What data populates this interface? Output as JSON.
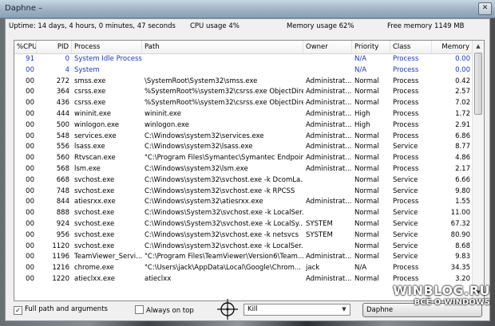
{
  "window": {
    "title": "Daphne –",
    "close_glyph": "✕"
  },
  "stats": {
    "uptime": "Uptime: 14 days, 4 hours, 0 minutes, 47 seconds",
    "cpu": "CPU usage  4%",
    "memory": "Memory usage  62%",
    "free": "Free memory 1149 MB"
  },
  "columns": [
    "%CPU",
    "PID",
    "Process",
    "Path",
    "Owner",
    "Priority",
    "Class",
    "Memory"
  ],
  "rows": [
    {
      "cpu": "91",
      "pid": "0",
      "process": "System Idle Process",
      "path": "",
      "owner": "",
      "priority": "N/A",
      "class": "Process",
      "memory": "0.00",
      "blue": true
    },
    {
      "cpu": "00",
      "pid": "4",
      "process": "System",
      "path": "",
      "owner": "",
      "priority": "N/A",
      "class": "Process",
      "memory": "0.00",
      "blue": true
    },
    {
      "cpu": "00",
      "pid": "272",
      "process": "smss.exe",
      "path": "\\SystemRoot\\System32\\smss.exe",
      "owner": "Administrat...",
      "priority": "Normal",
      "class": "Process",
      "memory": "0.42"
    },
    {
      "cpu": "00",
      "pid": "364",
      "process": "csrss.exe",
      "path": "%SystemRoot%\\system32\\csrss.exe ObjectDire...",
      "owner": "Administrat...",
      "priority": "Normal",
      "class": "Process",
      "memory": "2.57"
    },
    {
      "cpu": "00",
      "pid": "436",
      "process": "csrss.exe",
      "path": "%SystemRoot%\\system32\\csrss.exe ObjectDire...",
      "owner": "Administrat...",
      "priority": "Normal",
      "class": "Process",
      "memory": "7.02"
    },
    {
      "cpu": "00",
      "pid": "444",
      "process": "wininit.exe",
      "path": "wininit.exe",
      "owner": "Administrat...",
      "priority": "High",
      "class": "Process",
      "memory": "1.72"
    },
    {
      "cpu": "00",
      "pid": "500",
      "process": "winlogon.exe",
      "path": "winlogon.exe",
      "owner": "Administrat...",
      "priority": "High",
      "class": "Process",
      "memory": "2.91"
    },
    {
      "cpu": "00",
      "pid": "548",
      "process": "services.exe",
      "path": "C:\\Windows\\system32\\services.exe",
      "owner": "Administrat...",
      "priority": "Normal",
      "class": "Process",
      "memory": "6.86"
    },
    {
      "cpu": "00",
      "pid": "556",
      "process": "lsass.exe",
      "path": "C:\\Windows\\system32\\lsass.exe",
      "owner": "Administrat...",
      "priority": "Normal",
      "class": "Service",
      "memory": "8.77"
    },
    {
      "cpu": "00",
      "pid": "560",
      "process": "Rtvscan.exe",
      "path": "\"C:\\Program Files\\Symantec\\Symantec Endpoin...",
      "owner": "Administrat...",
      "priority": "Normal",
      "class": "Process",
      "memory": "4.86"
    },
    {
      "cpu": "00",
      "pid": "568",
      "process": "lsm.exe",
      "path": "C:\\Windows\\system32\\lsm.exe",
      "owner": "Administrat...",
      "priority": "Normal",
      "class": "Process",
      "memory": "2.17"
    },
    {
      "cpu": "00",
      "pid": "668",
      "process": "svchost.exe",
      "path": "C:\\Windows\\system32\\svchost.exe -k DcomLa...",
      "owner": "",
      "priority": "Normal",
      "class": "Service",
      "memory": "6.66"
    },
    {
      "cpu": "00",
      "pid": "748",
      "process": "svchost.exe",
      "path": "C:\\Windows\\system32\\svchost.exe -k RPCSS",
      "owner": "",
      "priority": "Normal",
      "class": "Service",
      "memory": "9.80"
    },
    {
      "cpu": "00",
      "pid": "844",
      "process": "atiesrxx.exe",
      "path": "C:\\Windows\\system32\\atiesrxx.exe",
      "owner": "Administrat...",
      "priority": "Normal",
      "class": "Process",
      "memory": "1.55"
    },
    {
      "cpu": "00",
      "pid": "888",
      "process": "svchost.exe",
      "path": "C:\\Windows\\System32\\svchost.exe -k LocalSer...",
      "owner": "",
      "priority": "Normal",
      "class": "Service",
      "memory": "11.00"
    },
    {
      "cpu": "00",
      "pid": "924",
      "process": "svchost.exe",
      "path": "C:\\Windows\\System32\\svchost.exe -k LocalSy...",
      "owner": "SYSTEM",
      "priority": "Normal",
      "class": "Service",
      "memory": "67.32"
    },
    {
      "cpu": "00",
      "pid": "956",
      "process": "svchost.exe",
      "path": "C:\\Windows\\system32\\svchost.exe -k netsvcs",
      "owner": "SYSTEM",
      "priority": "Normal",
      "class": "Service",
      "memory": "80.90"
    },
    {
      "cpu": "00",
      "pid": "1120",
      "process": "svchost.exe",
      "path": "C:\\Windows\\system32\\svchost.exe -k LocalSer...",
      "owner": "",
      "priority": "Normal",
      "class": "Service",
      "memory": "8.68"
    },
    {
      "cpu": "00",
      "pid": "1196",
      "process": "TeamViewer_Servi...",
      "path": "\"C:\\Program Files\\TeamViewer\\Version6\\Team...",
      "owner": "Administrat...",
      "priority": "Normal",
      "class": "Service",
      "memory": "9.83"
    },
    {
      "cpu": "00",
      "pid": "1216",
      "process": "chrome.exe",
      "path": "\"C:\\Users\\jack\\AppData\\Local\\Google\\Chrom...",
      "owner": "jack",
      "priority": "N/A",
      "class": "Process",
      "memory": "34.35"
    },
    {
      "cpu": "00",
      "pid": "1220",
      "process": "atieclxx.exe",
      "path": "atieclxx",
      "owner": "Administrat...",
      "priority": "Normal",
      "class": "Process",
      "memory": "3.20"
    }
  ],
  "bottom": {
    "full_path_label": "Full path and arguments",
    "full_path_checked": true,
    "always_on_top_label": "Always on top",
    "always_on_top_checked": false,
    "action_select_value": "Kill",
    "button_label": "Daphne"
  },
  "watermark": {
    "line1": "WINBLOG.RU",
    "line2": "ВСЁ О WINDOWS"
  }
}
